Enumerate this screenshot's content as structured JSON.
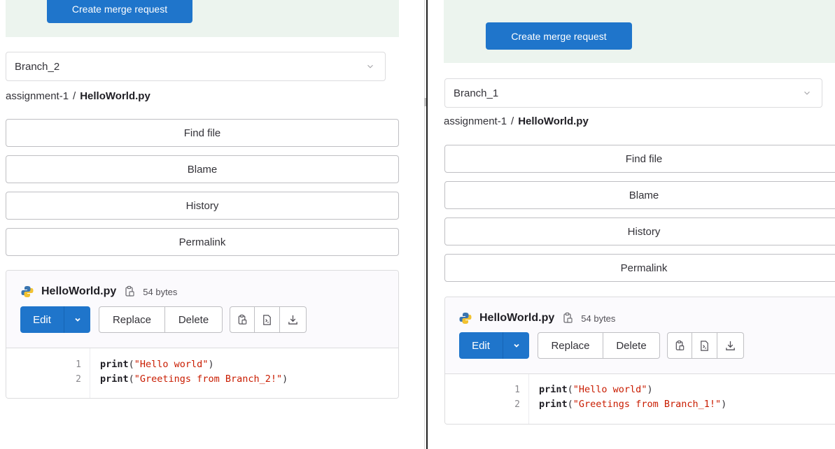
{
  "panes": {
    "left": {
      "create_mr_label": "Create merge request",
      "branch": "Branch_2",
      "breadcrumb": {
        "project": "assignment-1",
        "separator": "/",
        "file": "HelloWorld.py"
      },
      "buttons": {
        "find_file": "Find file",
        "blame": "Blame",
        "history": "History",
        "permalink": "Permalink"
      },
      "file": {
        "name": "HelloWorld.py",
        "size": "54 bytes",
        "edit_label": "Edit",
        "replace_label": "Replace",
        "delete_label": "Delete",
        "lines": [
          {
            "num": "1",
            "fn": "print",
            "open": "(",
            "str": "\"Hello world\"",
            "close": ")"
          },
          {
            "num": "2",
            "fn": "print",
            "open": "(",
            "str": "\"Greetings from Branch_2!\"",
            "close": ")"
          }
        ]
      }
    },
    "right": {
      "create_mr_label": "Create merge request",
      "branch": "Branch_1",
      "breadcrumb": {
        "project": "assignment-1",
        "separator": "/",
        "file": "HelloWorld.py"
      },
      "buttons": {
        "find_file": "Find file",
        "blame": "Blame",
        "history": "History",
        "permalink": "Permalink"
      },
      "file": {
        "name": "HelloWorld.py",
        "size": "54 bytes",
        "edit_label": "Edit",
        "replace_label": "Replace",
        "delete_label": "Delete",
        "lines": [
          {
            "num": "1",
            "fn": "print",
            "open": "(",
            "str": "\"Hello world\"",
            "close": ")"
          },
          {
            "num": "2",
            "fn": "print",
            "open": "(",
            "str": "\"Greetings from Branch_1!\"",
            "close": ")"
          }
        ]
      }
    }
  },
  "colors": {
    "primary": "#1f75cb",
    "banner_bg": "#ecf4ee",
    "string": "#c91c00",
    "border": "#bfbfc3"
  },
  "icons": {
    "chevron": "chevron-down-icon",
    "python": "python-icon",
    "copy": "copy-icon",
    "copy_contents": "copy-contents-icon",
    "raw": "raw-file-icon",
    "download": "download-icon"
  }
}
